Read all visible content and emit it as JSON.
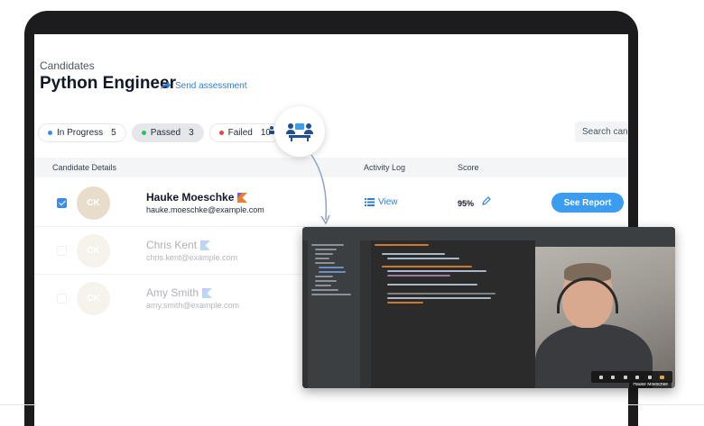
{
  "header": {
    "pretitle": "Candidates",
    "title": "Python Engineer",
    "send_assessment": "Send assessment"
  },
  "filters": [
    {
      "label": "In Progress",
      "count": "5",
      "color": "#3b8ee8"
    },
    {
      "label": "Passed",
      "count": "3",
      "color": "#22c55e"
    },
    {
      "label": "Failed",
      "count": "10",
      "color": "#ef4444"
    }
  ],
  "search": {
    "placeholder": "Search cand"
  },
  "table": {
    "columns": [
      "Candidate Details",
      "Activity Log",
      "Score"
    ],
    "rows": [
      {
        "initials": "CK",
        "name": "Hauke Moeschke",
        "email": "hauke.moeschke@example.com",
        "view": "View",
        "score": "95%",
        "report": "See Report",
        "checked": true
      },
      {
        "initials": "CK",
        "name": "Chris Kent",
        "email": "chris.kent@example.com"
      },
      {
        "initials": "CK",
        "name": "Amy Smith",
        "email": "amy.smith@example.com"
      }
    ]
  },
  "video_call": {
    "participant_name": "Hauke Moeschke"
  },
  "colors": {
    "accent": "#2f7fd8",
    "button": "#3b9cf0",
    "avatar": "#e8dccb"
  }
}
